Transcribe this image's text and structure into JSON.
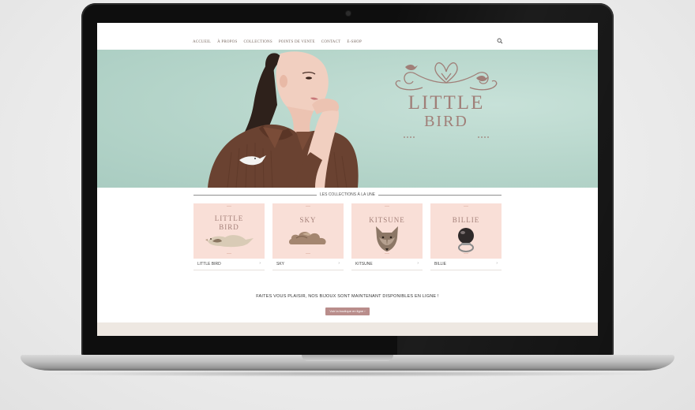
{
  "nav": {
    "items": [
      {
        "label": "ACCUEIL"
      },
      {
        "label": "À PROPOS"
      },
      {
        "label": "COLLECTIONS"
      },
      {
        "label": "POINTS DE VENTE"
      },
      {
        "label": "CONTACT"
      },
      {
        "label": "E-SHOP"
      }
    ],
    "search_icon": "search-icon"
  },
  "hero": {
    "logo_line1": "LITTLE",
    "logo_line2": "BIRD"
  },
  "collections": {
    "heading": "LES COLLECTIONS À LA UNE",
    "items": [
      {
        "title_line1": "LITTLE",
        "title_line2": "BIRD",
        "label": "LITTLE BIRD",
        "arrow": "›"
      },
      {
        "title_line1": "SKY",
        "title_line2": "",
        "label": "SKY",
        "arrow": "›"
      },
      {
        "title_line1": "KITSUNE",
        "title_line2": "",
        "label": "KITSUNE",
        "arrow": "›"
      },
      {
        "title_line1": "BILLIE",
        "title_line2": "",
        "label": "BILLIE",
        "arrow": "›"
      }
    ]
  },
  "promo": {
    "tagline": "FAITES VOUS PLAISIR, NOS BIJOUX SONT MAINTENANT DISPONIBLES EN LIGNE !",
    "cta_label": "Voir la boutique en ligne ›"
  },
  "colors": {
    "hero_bg": "#b7d6cc",
    "card_bg": "#f9dfd7",
    "accent": "#b98d8b",
    "logo": "#a07f78"
  }
}
